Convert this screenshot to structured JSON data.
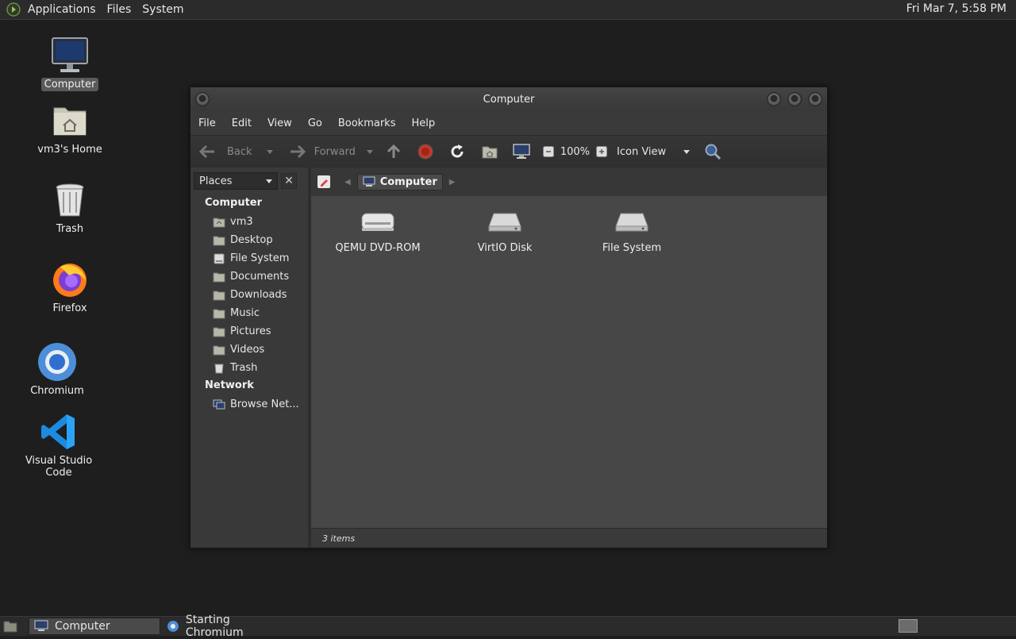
{
  "top_panel": {
    "menus": [
      "Applications",
      "Files",
      "System"
    ],
    "clock": "Fri Mar  7,  5:58 PM"
  },
  "desktop": {
    "icons": [
      {
        "label": "Computer",
        "icon": "monitor-icon",
        "selected": true
      },
      {
        "label": "vm3's Home",
        "icon": "home-folder-icon"
      },
      {
        "label": "Trash",
        "icon": "trash-icon"
      },
      {
        "label": "Firefox",
        "icon": "firefox-icon"
      },
      {
        "label": "Chromium",
        "icon": "chromium-icon"
      },
      {
        "label": "Visual Studio Code",
        "icon": "vscode-icon"
      }
    ]
  },
  "window": {
    "title": "Computer",
    "menubar": [
      "File",
      "Edit",
      "View",
      "Go",
      "Bookmarks",
      "Help"
    ],
    "toolbar": {
      "back": "Back",
      "forward": "Forward",
      "zoom": "100%",
      "view_mode": "Icon View"
    },
    "sidebar": {
      "selector": "Places",
      "sections": [
        {
          "heading": "Computer",
          "items": [
            "vm3",
            "Desktop",
            "File System",
            "Documents",
            "Downloads",
            "Music",
            "Pictures",
            "Videos",
            "Trash"
          ]
        },
        {
          "heading": "Network",
          "items": [
            "Browse Net..."
          ]
        }
      ]
    },
    "pathbar": {
      "current": "Computer"
    },
    "files": [
      "QEMU DVD-ROM",
      "VirtIO Disk",
      "File System"
    ],
    "status": "3 items"
  },
  "taskbar": {
    "tasks": [
      {
        "label": "Computer",
        "active": true
      },
      {
        "label": "Starting Chromium",
        "active": false
      }
    ]
  }
}
